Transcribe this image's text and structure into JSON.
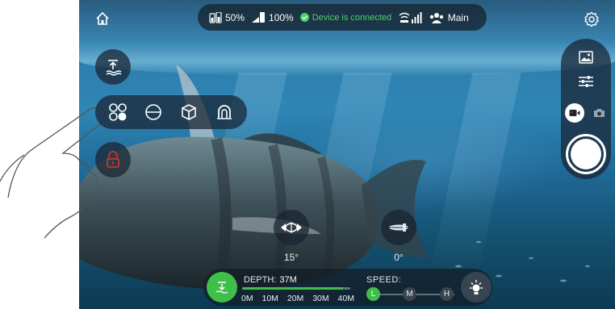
{
  "status": {
    "phone_battery": "50%",
    "drone_battery": "100%",
    "connection": "Device is connected",
    "user_mode": "Main"
  },
  "tilt": {
    "pitch_label": "15°",
    "roll_label": "0°"
  },
  "depth": {
    "label": "DEPTH:",
    "value": "37M",
    "fill_fraction": 0.93,
    "ticks": [
      "0M",
      "10M",
      "20M",
      "30M",
      "40M"
    ]
  },
  "speed": {
    "label": "SPEED:",
    "options": [
      "L",
      "M",
      "H"
    ],
    "selected": "L"
  },
  "colors": {
    "accent": "#3fbf4a",
    "record": "#c8342e"
  },
  "icons": {
    "home": "home-icon",
    "settings": "gear-icon",
    "surface": "surface-icon",
    "modes": "modes-icon",
    "lock": "lock-icon",
    "gallery": "gallery-icon",
    "adjust": "sliders-icon",
    "video": "video-icon",
    "photo": "camera-icon",
    "light": "light-icon"
  }
}
